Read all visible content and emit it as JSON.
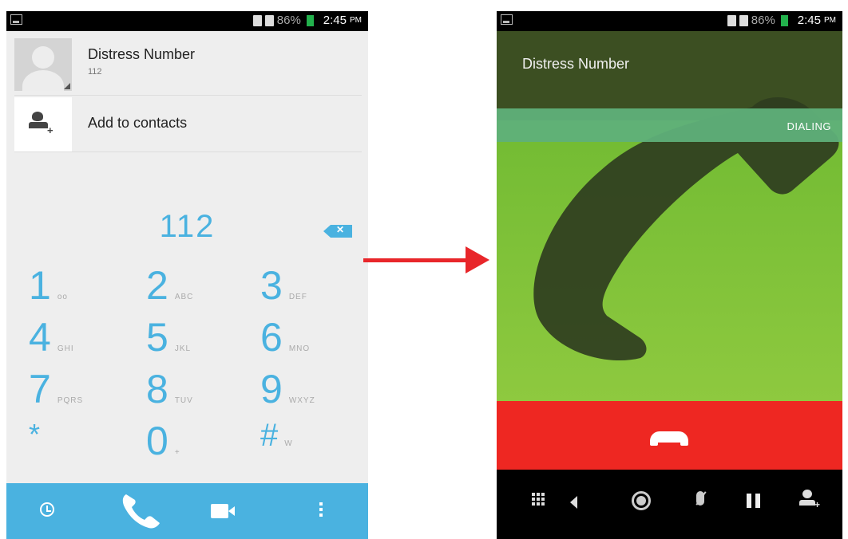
{
  "left": {
    "status": {
      "battery": "86%",
      "time": "2:45",
      "ampm": "PM"
    },
    "contact": {
      "name": "Distress Number",
      "number": "112"
    },
    "add_contact_label": "Add to contacts",
    "dialed_digits": "112",
    "keypad": [
      {
        "n": "1",
        "l": "oo"
      },
      {
        "n": "2",
        "l": "ABC"
      },
      {
        "n": "3",
        "l": "DEF"
      },
      {
        "n": "4",
        "l": "GHI"
      },
      {
        "n": "5",
        "l": "JKL"
      },
      {
        "n": "6",
        "l": "MNO"
      },
      {
        "n": "7",
        "l": "PQRS"
      },
      {
        "n": "8",
        "l": "TUV"
      },
      {
        "n": "9",
        "l": "WXYZ"
      },
      {
        "n": "*",
        "l": ""
      },
      {
        "n": "0",
        "l": "+"
      },
      {
        "n": "#",
        "l": "W"
      }
    ]
  },
  "right": {
    "status": {
      "battery": "86%",
      "time": "2:45",
      "ampm": "PM"
    },
    "caller_name": "Distress Number",
    "call_state": "DIALING"
  },
  "colors": {
    "accent_blue": "#4ab2e0",
    "end_call_red": "#ee2722",
    "call_green": "#7fc33a"
  }
}
